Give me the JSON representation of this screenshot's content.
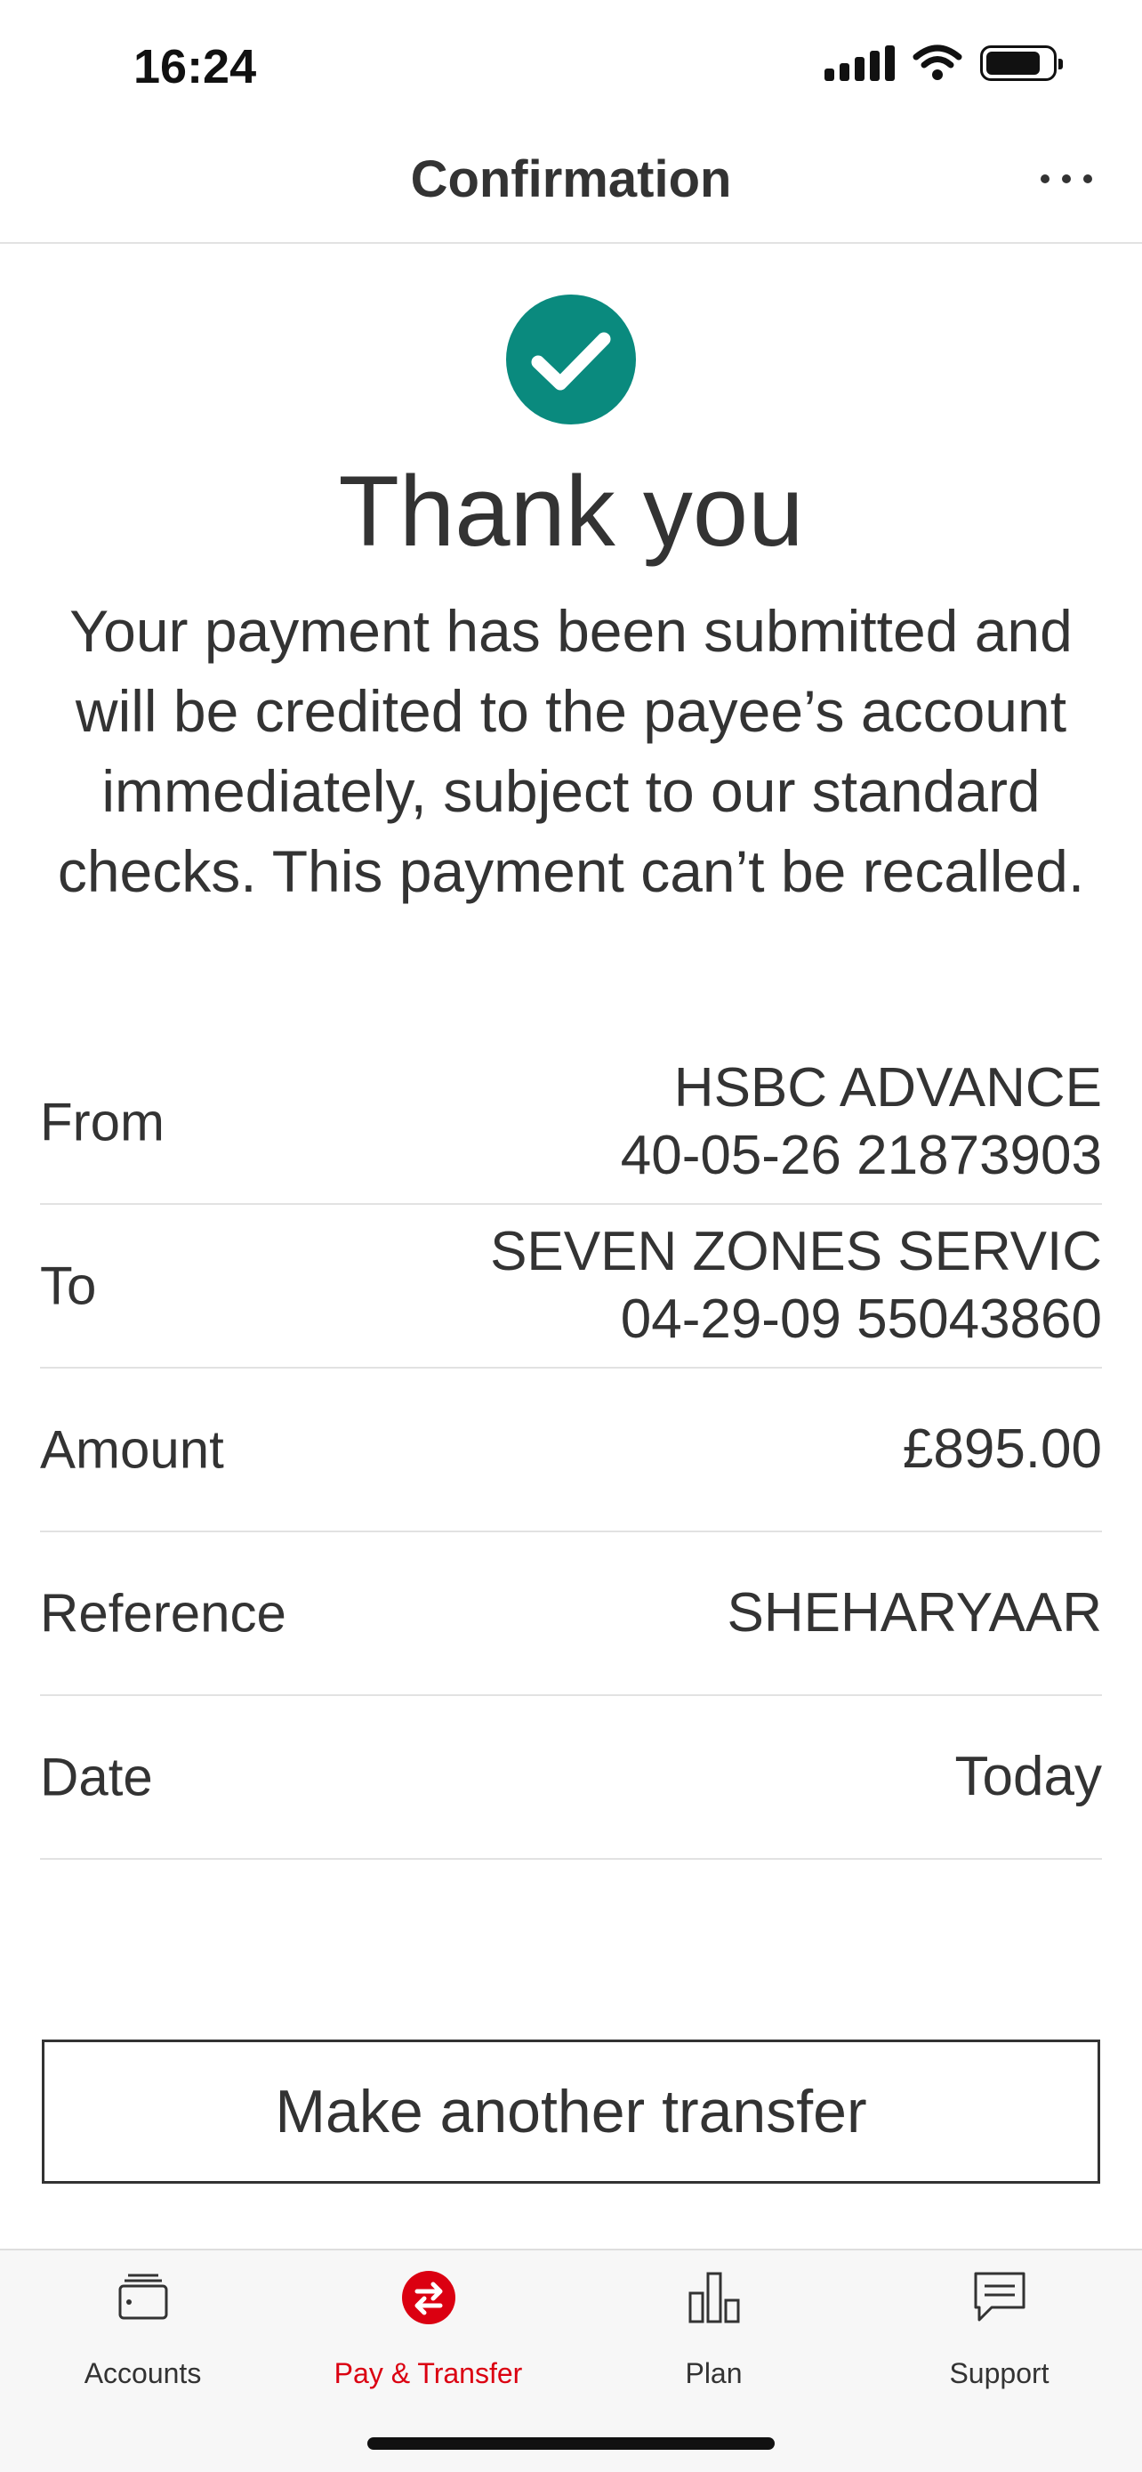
{
  "status_bar": {
    "time": "16:24"
  },
  "header": {
    "title": "Confirmation"
  },
  "success": {
    "title": "Thank you",
    "message": "Your payment has been submitted and will be credited to the payee’s account immediately, subject to our standard checks. This payment can’t be recalled."
  },
  "details": [
    {
      "label": "From",
      "value_line1": "HSBC ADVANCE",
      "value_line2": "40-05-26 21873903"
    },
    {
      "label": "To",
      "value_line1": "SEVEN ZONES SERVIC",
      "value_line2": "04-29-09 55043860"
    },
    {
      "label": "Amount",
      "value_line1": "£895.00"
    },
    {
      "label": "Reference",
      "value_line1": "SHEHARYAAR"
    },
    {
      "label": "Date",
      "value_line1": "Today"
    }
  ],
  "actions": {
    "make_another_label": "Make another transfer"
  },
  "tab_bar": {
    "tabs": [
      {
        "label": "Accounts",
        "icon": "wallet-icon",
        "active": false
      },
      {
        "label": "Pay & Transfer",
        "icon": "transfer-icon",
        "active": true
      },
      {
        "label": "Plan",
        "icon": "bar-chart-icon",
        "active": false
      },
      {
        "label": "Support",
        "icon": "chat-icon",
        "active": false
      }
    ]
  },
  "colors": {
    "accent_red": "#db0011",
    "success_teal": "#0a8a7e",
    "text": "#333333"
  }
}
